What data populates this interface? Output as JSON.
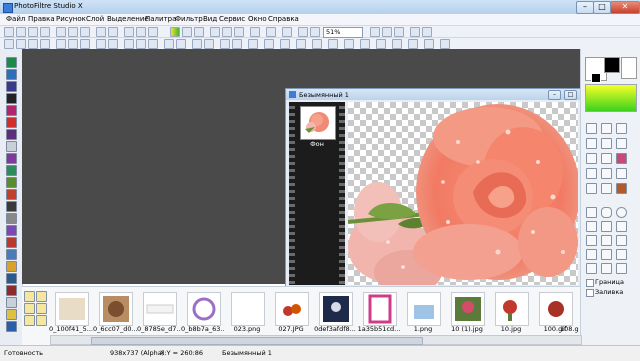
{
  "window": {
    "title": "PhotoFiltre Studio X"
  },
  "menu": [
    "Файл",
    "Правка",
    "Рисунок",
    "Слой",
    "Выделение",
    "Палитра",
    "Фильтр",
    "Вид",
    "Сервис",
    "Окно",
    "Справка"
  ],
  "toolbar": {
    "zoom_value": "51%"
  },
  "document": {
    "title": "Безымянный 1",
    "layer_name": "Фон"
  },
  "right_panel": {
    "border_label": "Граница",
    "fill_label": "Заливка"
  },
  "browser": {
    "files": [
      "0_100f41_5...",
      "0_6cc07_d0...",
      "0_8785e_d7...",
      "0_b8b7a_63...",
      "023.png",
      "027.JPG",
      "0def3afdf8...",
      "1a35b51cd...",
      "1.png",
      "10 (1).jpg",
      "10.jpg",
      "100.gif",
      "108.g"
    ]
  },
  "status": {
    "ready": "Готовность",
    "dims": "938x737 (Alpha)",
    "coords": "X:Y = 260:86",
    "doc": "Безымянный 1"
  },
  "colors": {
    "foreground": "#000000",
    "background": "#ffffff",
    "gradient_start": "#f7ff2a",
    "gradient_end": "#3bd21c"
  }
}
